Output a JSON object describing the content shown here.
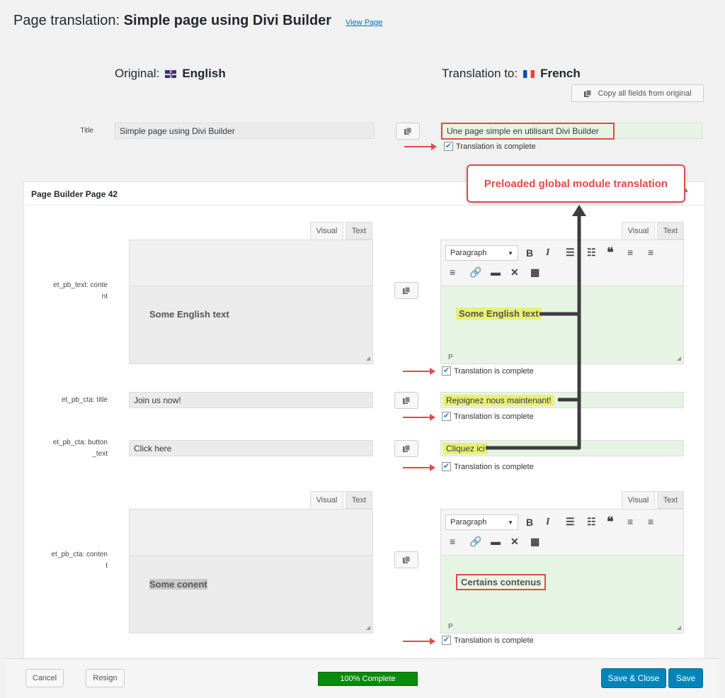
{
  "header": {
    "title_prefix": "Page translation:",
    "title_name": "Simple page using Divi Builder",
    "view_page_link": "View Page"
  },
  "columns": {
    "original_label": "Original:",
    "original_lang": "English",
    "translation_label": "Translation to:",
    "translation_lang": "French",
    "copy_all_button": "Copy all fields from original"
  },
  "title_field": {
    "label": "Title",
    "original": "Simple page using Divi Builder",
    "translation": "Une page simple en utilisant Divi Builder",
    "complete_label": "Translation is complete"
  },
  "callout": "Preloaded global module translation",
  "panel": {
    "title": "Page Builder Page 42",
    "tab_visual": "Visual",
    "tab_text": "Text",
    "format_select": "Paragraph",
    "status_path": "P",
    "complete_label": "Translation is complete",
    "fields": [
      {
        "label_line1": "et_pb_text: conte",
        "label_line2": "nt",
        "original": "Some English text",
        "translation": "Some English text"
      },
      {
        "label_line1": "et_pb_cta: title",
        "original": "Join us now!",
        "translation": "Rejoignez nous maintenant!"
      },
      {
        "label_line1": "et_pb_cta: button",
        "label_line2": "_text",
        "original": "Click here",
        "translation": "Cliquez ici"
      },
      {
        "label_line1": "et_pb_cta: conten",
        "label_line2": "t",
        "original": "Some conent",
        "translation": "Certains contenus"
      }
    ]
  },
  "footer": {
    "cancel": "Cancel",
    "resign": "Resign",
    "progress": "100% Complete",
    "progress_value": 1.0,
    "save_close": "Save & Close",
    "save": "Save"
  },
  "colors": {
    "accent": "#0085ba",
    "annotation": "#e04a4a",
    "translation_bg": "#e6f5e3",
    "progress": "#0a8a0a"
  }
}
